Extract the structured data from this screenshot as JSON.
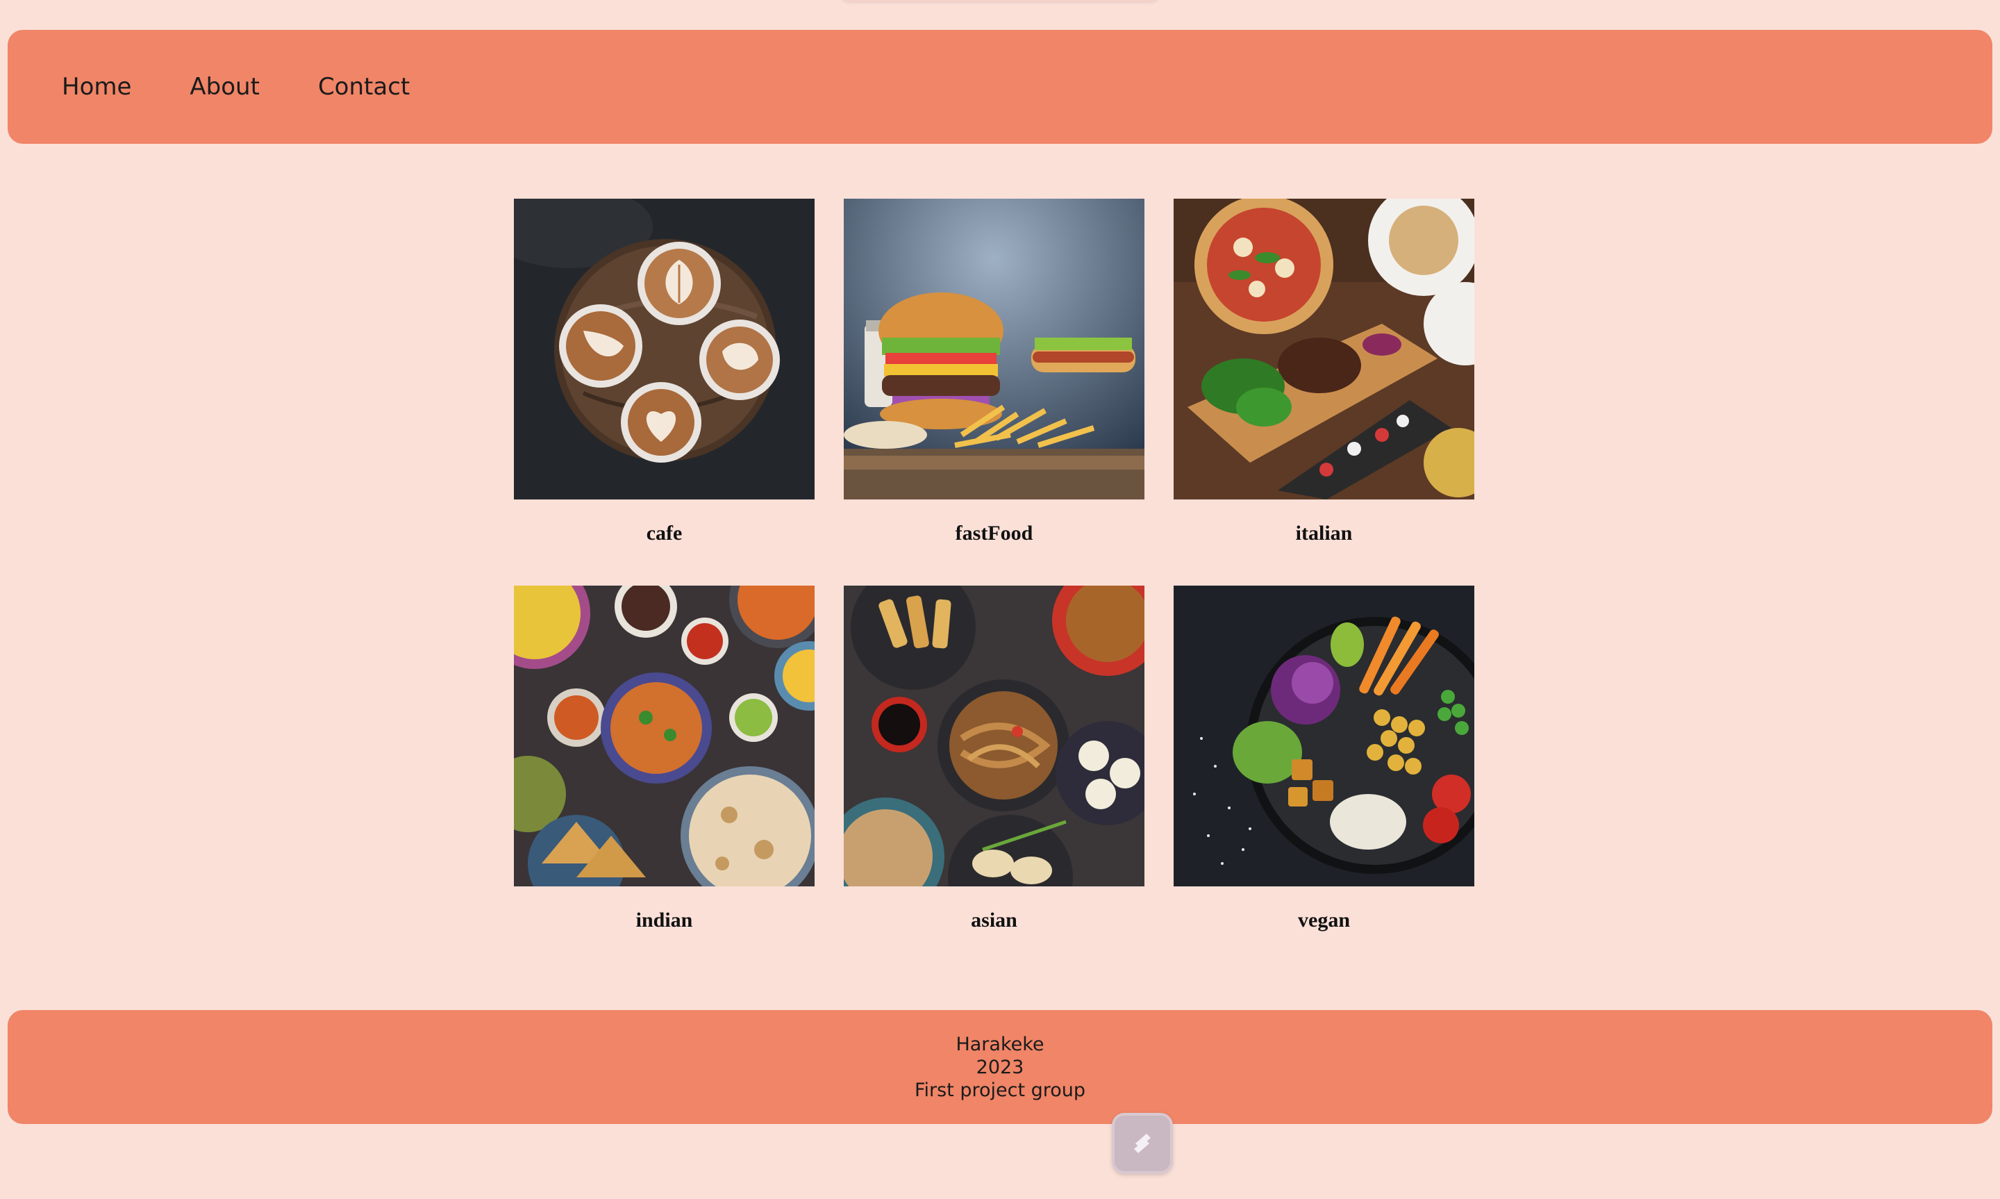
{
  "nav": {
    "links": [
      "Home",
      "About",
      "Contact"
    ]
  },
  "categories": [
    {
      "label": "cafe",
      "image": "latte-art-cups"
    },
    {
      "label": "fastFood",
      "image": "burger-and-fries"
    },
    {
      "label": "italian",
      "image": "pizza-and-steak-board"
    },
    {
      "label": "indian",
      "image": "curry-and-naan-spread"
    },
    {
      "label": "asian",
      "image": "noodles-and-dumplings-spread"
    },
    {
      "label": "vegan",
      "image": "buddha-bowl"
    }
  ],
  "footer": {
    "line1": "Harakeke",
    "line2": "2023",
    "line3": "First project group"
  },
  "colors": {
    "background": "#fbe0d8",
    "bar": "#f08567"
  },
  "floating_button": {
    "icon": "stack-icon"
  }
}
